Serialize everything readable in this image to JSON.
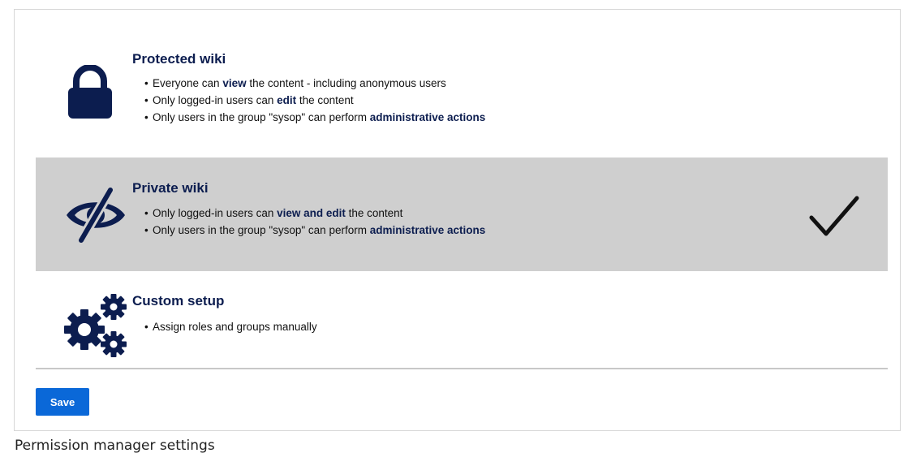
{
  "options": [
    {
      "id": "protected",
      "icon": "lock-icon",
      "title": "Protected wiki",
      "selected": false,
      "bullets": [
        {
          "before": "Everyone can ",
          "bold": "view",
          "after": " the content - including anonymous users"
        },
        {
          "before": "Only logged-in users can ",
          "bold": "edit",
          "after": " the content"
        },
        {
          "before": "Only users in the group \"sysop\" can perform ",
          "bold": "administrative actions",
          "after": ""
        }
      ]
    },
    {
      "id": "private",
      "icon": "eye-slash-icon",
      "title": "Private wiki",
      "selected": true,
      "bullets": [
        {
          "before": "Only logged-in users can ",
          "bold": "view and edit",
          "after": " the content"
        },
        {
          "before": "Only users in the group \"sysop\" can perform ",
          "bold": "administrative actions",
          "after": ""
        }
      ]
    },
    {
      "id": "custom",
      "icon": "gears-icon",
      "title": "Custom setup",
      "selected": false,
      "bullets": [
        {
          "before": "Assign roles and groups manually",
          "bold": "",
          "after": ""
        }
      ]
    }
  ],
  "save_label": "Save",
  "caption": "Permission manager settings",
  "colors": {
    "icon": "#0c1d4f",
    "selected_bg": "#cfcfcf",
    "save_button": "#0a68d8"
  }
}
